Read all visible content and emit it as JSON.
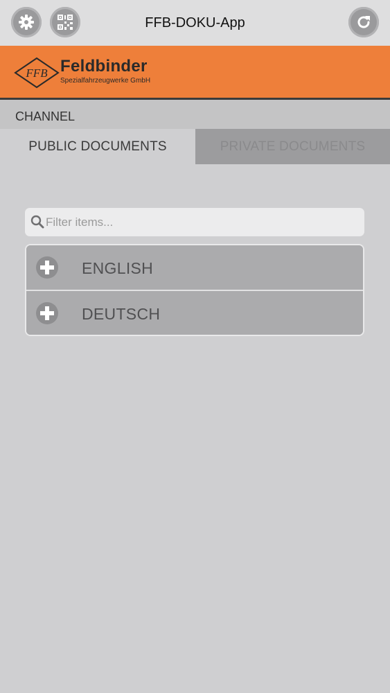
{
  "header": {
    "title": "FFB-DOKU-App",
    "settings_icon": "gear-icon",
    "qr_icon": "qr-code-icon",
    "refresh_icon": "refresh-icon"
  },
  "brand": {
    "monogram": "FFB",
    "name": "Feldbinder",
    "subtitle": "Spezialfahrzeugwerke GmbH",
    "color": "#ee7f3a"
  },
  "channel": {
    "label": "CHANNEL"
  },
  "tabs": [
    {
      "label": "PUBLIC DOCUMENTS",
      "active": true
    },
    {
      "label": "PRIVATE DOCUMENTS",
      "active": false
    }
  ],
  "search": {
    "placeholder": "Filter items...",
    "value": ""
  },
  "list": {
    "items": [
      {
        "label": "ENGLISH",
        "icon": "plus-icon"
      },
      {
        "label": "DEUTSCH",
        "icon": "plus-icon"
      }
    ]
  }
}
